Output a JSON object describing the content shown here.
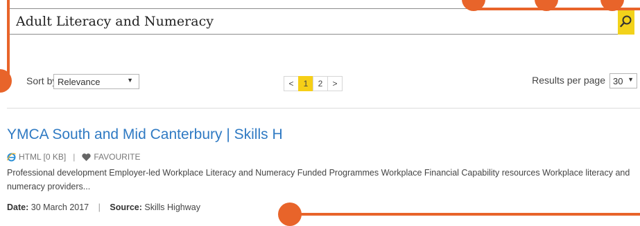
{
  "search": {
    "value": "Adult Literacy and Numeracy",
    "placeholder": ""
  },
  "controls": {
    "sort_label": "Sort by",
    "sort_value": "Relevance",
    "results_per_page_label": "Results per page",
    "results_per_page_value": "30",
    "pagination": {
      "prev": "<",
      "pages": [
        "1",
        "2"
      ],
      "active": "1",
      "next": ">"
    }
  },
  "results": [
    {
      "title": "YMCA South and Mid Canterbury | Skills H",
      "format": "HTML [0 KB]",
      "favourite_label": "FAVOURITE",
      "snippet": "Professional development  Employer-led Workplace Literacy and Numeracy Funded Programmes  Workplace Financial Capability resources  Workplace literacy and numeracy providers...",
      "date_label": "Date:",
      "date": "30 March 2017",
      "source_label": "Source:",
      "source": "Skills Highway"
    }
  ],
  "colors": {
    "accent_yellow": "#f6cf17",
    "link_blue": "#2f7ac3",
    "overlay_orange": "#e8642a"
  }
}
